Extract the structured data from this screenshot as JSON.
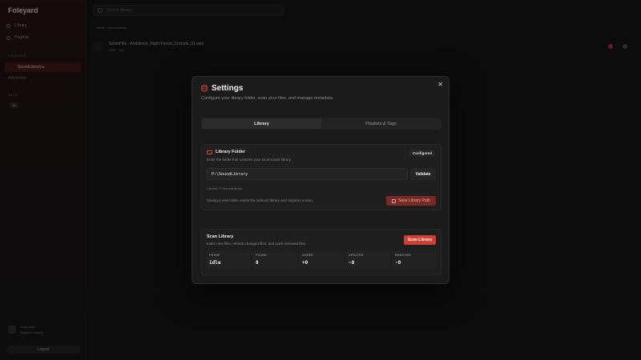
{
  "app": {
    "title": "Foleyard",
    "nav": [
      "Library",
      "Playlists"
    ],
    "section_libraries": "FOLDERS",
    "library_item": "SoundLibrary ▸",
    "add_folder": "Add folder",
    "section_tags": "TAGS",
    "tag": "sfx",
    "user_name": "Local user",
    "user_sub": "Signed in locally",
    "logout": "Logout",
    "search_placeholder": "Search library...",
    "breadcrumb": "Home  ›  SoundLibrary",
    "track_title": "Sound file - Ambience_Night Forest_Crickets_01.wav",
    "track_meta": "WAV · 48k"
  },
  "modal": {
    "title": "Settings",
    "subtitle": "Configure your library folder, scan your files, and manage metadata.",
    "tabs": [
      "Library",
      "Playlists & Tags"
    ],
    "active_tab": 0,
    "folder_card": {
      "title": "Library Folder",
      "status": "Configured",
      "description": "Enter the folder that contains your local sound library.",
      "path_value": "P:\\SoundLibrary",
      "validate_label": "Validate",
      "current_path": "Current: P:\\SoundLibrary",
      "note": "Saving a new folder resets the indexed library and requires a scan.",
      "save_label": "Save Library Path"
    },
    "scan_card": {
      "title": "Scan Library",
      "description": "Index new files, refresh changed files, and mark removed files.",
      "scan_label": "Scan Library",
      "stats": [
        {
          "label": "PHASE",
          "value": "idle"
        },
        {
          "label": "FOUND",
          "value": "0"
        },
        {
          "label": "ADDED",
          "value": "+0"
        },
        {
          "label": "UPDATED",
          "value": "~0"
        },
        {
          "label": "REMOVED",
          "value": "-0"
        }
      ]
    }
  },
  "colors": {
    "accent": "#cf3f33",
    "accent_muted": "#7a2a24",
    "modal_bg": "#1b1b1b"
  }
}
